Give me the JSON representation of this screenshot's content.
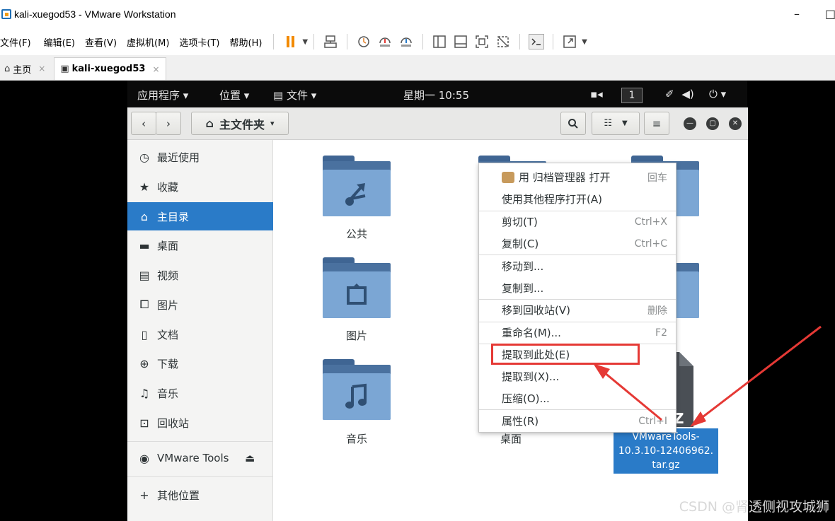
{
  "window": {
    "title": "kali-xuegod53 - VMware Workstation",
    "minimize": "–",
    "maximize": "□"
  },
  "menubar": {
    "items": [
      "文件(F)",
      "编辑(E)",
      "查看(V)",
      "虚拟机(M)",
      "选项卡(T)",
      "帮助(H)"
    ]
  },
  "tabs": {
    "home": "主页",
    "vm": "kali-xuegod53",
    "close": "×"
  },
  "topbar": {
    "applications": "应用程序 ▾",
    "places": "位置 ▾",
    "files_app": "文件 ▾",
    "clock": "星期一 10:55",
    "workspace": "1",
    "power": "⏻ ▾"
  },
  "headerbar": {
    "back": "‹",
    "forward": "›",
    "path_label": "主文件夹",
    "path_caret": "▾"
  },
  "sidebar": {
    "items": [
      {
        "label": "最近使用",
        "icon": "clock-icon"
      },
      {
        "label": "收藏",
        "icon": "star-icon"
      },
      {
        "label": "主目录",
        "icon": "home-icon"
      },
      {
        "label": "桌面",
        "icon": "desktop-folder-icon"
      },
      {
        "label": "视频",
        "icon": "film-icon"
      },
      {
        "label": "图片",
        "icon": "picture-icon"
      },
      {
        "label": "文档",
        "icon": "document-icon"
      },
      {
        "label": "下载",
        "icon": "download-icon"
      },
      {
        "label": "音乐",
        "icon": "music-icon"
      },
      {
        "label": "回收站",
        "icon": "trash-icon"
      }
    ],
    "device": "VMware Tools",
    "other_places": "其他位置"
  },
  "files": {
    "public": "公共",
    "pictures": "图片",
    "music": "音乐",
    "desktop": "桌面",
    "archive_name": "VMwareTools-10.3.10-12406962.tar.gz",
    "archive_lines": [
      "VMwareTools-",
      "10.3.10-12406962.",
      "tar.gz"
    ],
    "archive_badge": "Z"
  },
  "context_menu": {
    "items": [
      {
        "label": "用 归档管理器 打开",
        "accel": "回车"
      },
      {
        "label": "使用其他程序打开(A)",
        "accel": ""
      },
      {
        "label": "剪切(T)",
        "accel": "Ctrl+X"
      },
      {
        "label": "复制(C)",
        "accel": "Ctrl+C"
      },
      {
        "label": "移动到...",
        "accel": ""
      },
      {
        "label": "复制到...",
        "accel": ""
      },
      {
        "label": "移到回收站(V)",
        "accel": "删除"
      },
      {
        "label": "重命名(M)...",
        "accel": "F2"
      },
      {
        "label": "提取到此处(E)",
        "accel": ""
      },
      {
        "label": "提取到(X)...",
        "accel": ""
      },
      {
        "label": "压缩(O)...",
        "accel": ""
      },
      {
        "label": "属性(R)",
        "accel": "Ctrl+I"
      }
    ],
    "highlighted": "提取到此处(E)"
  },
  "colors": {
    "selection": "#2a7bc8",
    "annotation": "#e53935",
    "folder": "#7ba6d4"
  },
  "watermark": "CSDN @肾透侧视攻城狮"
}
